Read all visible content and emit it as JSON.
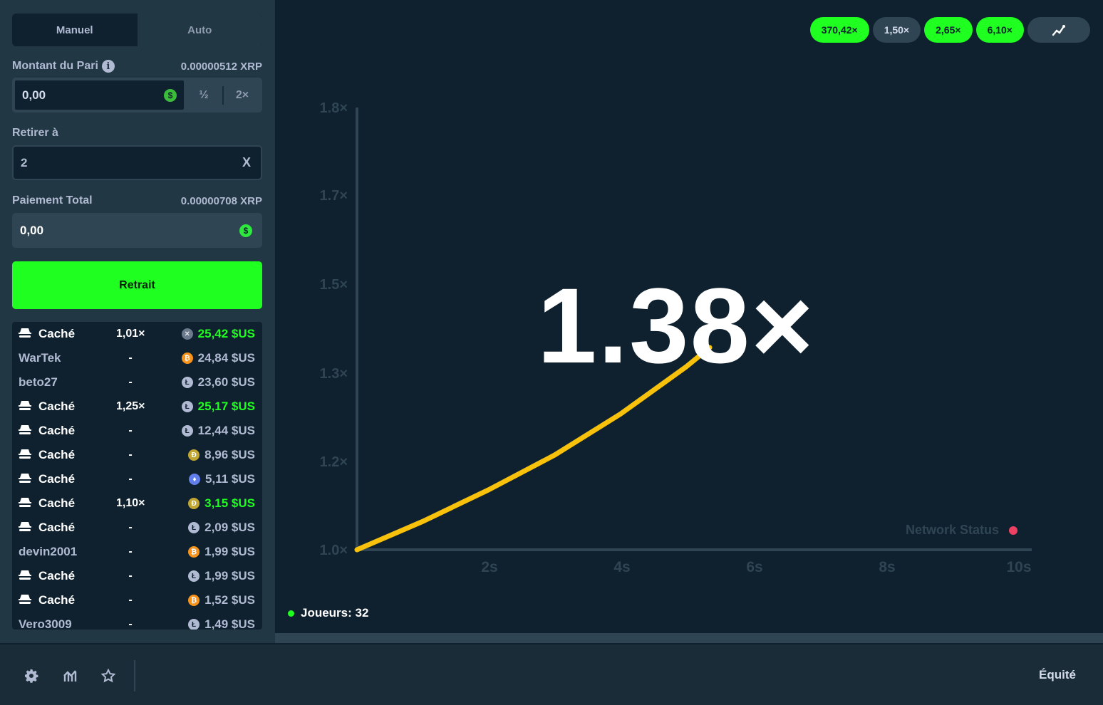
{
  "tabs": {
    "manual": "Manuel",
    "auto": "Auto"
  },
  "bet": {
    "label": "Montant du Pari",
    "crypto_value": "0.00000512 XRP",
    "amount": "0,00",
    "half_label": "½",
    "double_label": "2×"
  },
  "cashout": {
    "label": "Retirer à",
    "value": "2",
    "clear": "X"
  },
  "payout": {
    "label": "Paiement Total",
    "crypto_value": "0.00000708 XRP",
    "amount": "0,00"
  },
  "retrait_label": "Retrait",
  "players_list": [
    {
      "name": "Caché",
      "hidden": true,
      "mult": "1,01×",
      "coin": "xrp",
      "amount": "25,42 $US",
      "won": true
    },
    {
      "name": "WarTek",
      "hidden": false,
      "mult": "-",
      "coin": "btc",
      "amount": "24,84 $US",
      "won": false
    },
    {
      "name": "beto27",
      "hidden": false,
      "mult": "-",
      "coin": "ltc",
      "amount": "23,60 $US",
      "won": false
    },
    {
      "name": "Caché",
      "hidden": true,
      "mult": "1,25×",
      "coin": "ltc",
      "amount": "25,17 $US",
      "won": true
    },
    {
      "name": "Caché",
      "hidden": true,
      "mult": "-",
      "coin": "ltc",
      "amount": "12,44 $US",
      "won": false
    },
    {
      "name": "Caché",
      "hidden": true,
      "mult": "-",
      "coin": "doge",
      "amount": "8,96 $US",
      "won": false
    },
    {
      "name": "Caché",
      "hidden": true,
      "mult": "-",
      "coin": "eth",
      "amount": "5,11 $US",
      "won": false
    },
    {
      "name": "Caché",
      "hidden": true,
      "mult": "1,10×",
      "coin": "doge",
      "amount": "3,15 $US",
      "won": true
    },
    {
      "name": "Caché",
      "hidden": true,
      "mult": "-",
      "coin": "ltc",
      "amount": "2,09 $US",
      "won": false
    },
    {
      "name": "devin2001",
      "hidden": false,
      "mult": "-",
      "coin": "btc",
      "amount": "1,99 $US",
      "won": false
    },
    {
      "name": "Caché",
      "hidden": true,
      "mult": "-",
      "coin": "ltc",
      "amount": "1,99 $US",
      "won": false
    },
    {
      "name": "Caché",
      "hidden": true,
      "mult": "-",
      "coin": "btc",
      "amount": "1,52 $US",
      "won": false
    },
    {
      "name": "Vero3009",
      "hidden": false,
      "mult": "-",
      "coin": "ltc",
      "amount": "1,49 $US",
      "won": false
    }
  ],
  "coin_colors": {
    "xrp": "#6b7a8c",
    "btc": "#f7931a",
    "ltc": "#b1bad3",
    "doge": "#c2a633",
    "eth": "#627eea"
  },
  "history": [
    {
      "label": "370,42×",
      "style": "green"
    },
    {
      "label": "1,50×",
      "style": "grey"
    },
    {
      "label": "2,65×",
      "style": "green"
    },
    {
      "label": "6,10×",
      "style": "green"
    }
  ],
  "history_chart_icon": "trend-icon",
  "current_multiplier": "1.38×",
  "network_status": "Network Status",
  "players_count": "Joueurs: 32",
  "footer": {
    "icons": [
      "gear-icon",
      "stats-icon",
      "star-icon"
    ],
    "fairness": "Équité"
  },
  "chart_data": {
    "type": "line",
    "y_ticks": [
      "1.0×",
      "1.2×",
      "1.3×",
      "1.5×",
      "1.7×",
      "1.8×"
    ],
    "x_ticks": [
      "2s",
      "4s",
      "6s",
      "8s",
      "10s"
    ],
    "series": [
      {
        "x": [
          0,
          1,
          2,
          3,
          4,
          5,
          5.35
        ],
        "y": [
          1.0,
          1.045,
          1.095,
          1.15,
          1.215,
          1.29,
          1.32
        ]
      }
    ],
    "line_color": "#f8c10b"
  }
}
